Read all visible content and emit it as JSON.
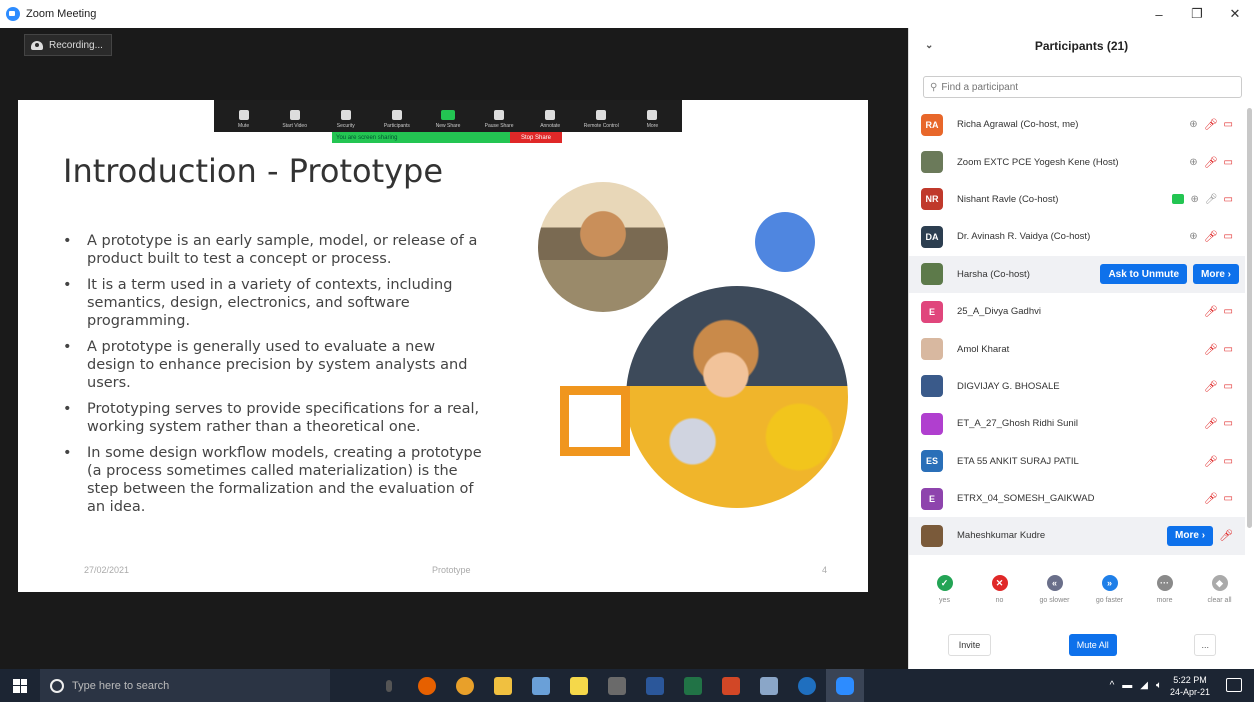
{
  "window": {
    "title": "Zoom Meeting",
    "controls": [
      "–",
      "❐",
      "✕"
    ]
  },
  "meeting": {
    "recording_label": "Recording...",
    "toolbar": [
      {
        "icon": "mic-icon",
        "label": "Mute"
      },
      {
        "icon": "video-icon",
        "label": "Start Video"
      },
      {
        "icon": "shield-icon",
        "label": "Security"
      },
      {
        "icon": "participants-icon",
        "label": "Participants"
      },
      {
        "icon": "new-share-icon",
        "label": "New Share"
      },
      {
        "icon": "pause-icon",
        "label": "Pause Share"
      },
      {
        "icon": "annotate-icon",
        "label": "Annotate"
      },
      {
        "icon": "remote-control-icon",
        "label": "Remote Control"
      },
      {
        "icon": "more-icon",
        "label": "More"
      }
    ],
    "share_status": "You are screen sharing",
    "stop_share": "Stop Share"
  },
  "slide": {
    "title": "Introduction - Prototype",
    "bullets": [
      "A prototype is an early sample, model, or release of a product built to test a concept or process.",
      "It is a term used in a variety of contexts, including semantics, design, electronics, and software programming.",
      "A prototype is generally used to evaluate a new design to enhance precision by system analysts and users.",
      "Prototyping serves to provide specifications for a real, working system rather than a theoretical one.",
      "In some design workflow models, creating a prototype (a process sometimes called materialization) is the step between the formalization and the evaluation of an idea."
    ],
    "footer_date": "27/02/2021",
    "footer_center": "Prototype",
    "footer_page": "4"
  },
  "participants": {
    "header": "Participants (21)",
    "search_placeholder": "Find a participant",
    "list": [
      {
        "name": "Richa Agrawal (Co-host, me)",
        "initials": "RA",
        "color": "#e8672a"
      },
      {
        "name": "Zoom EXTC PCE Yogesh Kene (Host)",
        "initials": "",
        "color": "#6b7a5a"
      },
      {
        "name": "Nishant Ravle (Co-host)",
        "initials": "NR",
        "color": "#c0392b"
      },
      {
        "name": "Dr. Avinash R. Vaidya (Co-host)",
        "initials": "DA",
        "color": "#2c3e50"
      },
      {
        "name": "Harsha (Co-host)",
        "initials": "",
        "color": "#5d7a4a"
      },
      {
        "name": "25_A_Divya Gadhvi",
        "initials": "E",
        "color": "#e0467c"
      },
      {
        "name": "Amol Kharat",
        "initials": "",
        "color": "#d8b8a0"
      },
      {
        "name": "DIGVIJAY G. BHOSALE",
        "initials": "",
        "color": "#3a5a8a"
      },
      {
        "name": "ET_A_27_Ghosh Ridhi Sunil",
        "initials": "",
        "color": "#b03fcf"
      },
      {
        "name": "ETA 55 ANKIT SURAJ PATIL",
        "initials": "ES",
        "color": "#2a6fb8"
      },
      {
        "name": "ETRX_04_SOMESH_GAIKWAD",
        "initials": "E",
        "color": "#8e44ad"
      },
      {
        "name": "Maheshkumar Kudre",
        "initials": "",
        "color": "#7a5a3a"
      }
    ],
    "ask_to_unmute": "Ask to Unmute",
    "more": "More ›",
    "reactions": [
      {
        "label": "yes",
        "symbol": "✓",
        "color": "#23a455"
      },
      {
        "label": "no",
        "symbol": "✕",
        "color": "#e02828"
      },
      {
        "label": "go slower",
        "symbol": "«",
        "color": "#6a6f8a"
      },
      {
        "label": "go faster",
        "symbol": "»",
        "color": "#1f7fe8"
      },
      {
        "label": "more",
        "symbol": "···",
        "color": "#8a8a8a"
      },
      {
        "label": "clear all",
        "symbol": "◆",
        "color": "#aaa"
      }
    ],
    "invite": "Invite",
    "mute_all": "Mute All",
    "more_dots": "..."
  },
  "taskbar": {
    "search_placeholder": "Type here to search",
    "time": "5:22 PM",
    "date": "24-Apr-21",
    "apps": [
      {
        "name": "mic-icon",
        "color": "#555"
      },
      {
        "name": "firefox-icon",
        "color": "#e66000"
      },
      {
        "name": "chrome-icon",
        "color": "#e8a02a"
      },
      {
        "name": "file-explorer-icon",
        "color": "#f0c040"
      },
      {
        "name": "paint-icon",
        "color": "#6aa0d8"
      },
      {
        "name": "sticky-notes-icon",
        "color": "#f5d84a"
      },
      {
        "name": "calculator-icon",
        "color": "#6a6a6a"
      },
      {
        "name": "word-icon",
        "color": "#2b579a"
      },
      {
        "name": "excel-icon",
        "color": "#217346"
      },
      {
        "name": "powerpoint-icon",
        "color": "#d24726"
      },
      {
        "name": "remote-desktop-icon",
        "color": "#8aa6c8"
      },
      {
        "name": "edge-icon",
        "color": "#1f6fbf"
      },
      {
        "name": "zoom-icon",
        "color": "#2d8cff"
      }
    ]
  }
}
